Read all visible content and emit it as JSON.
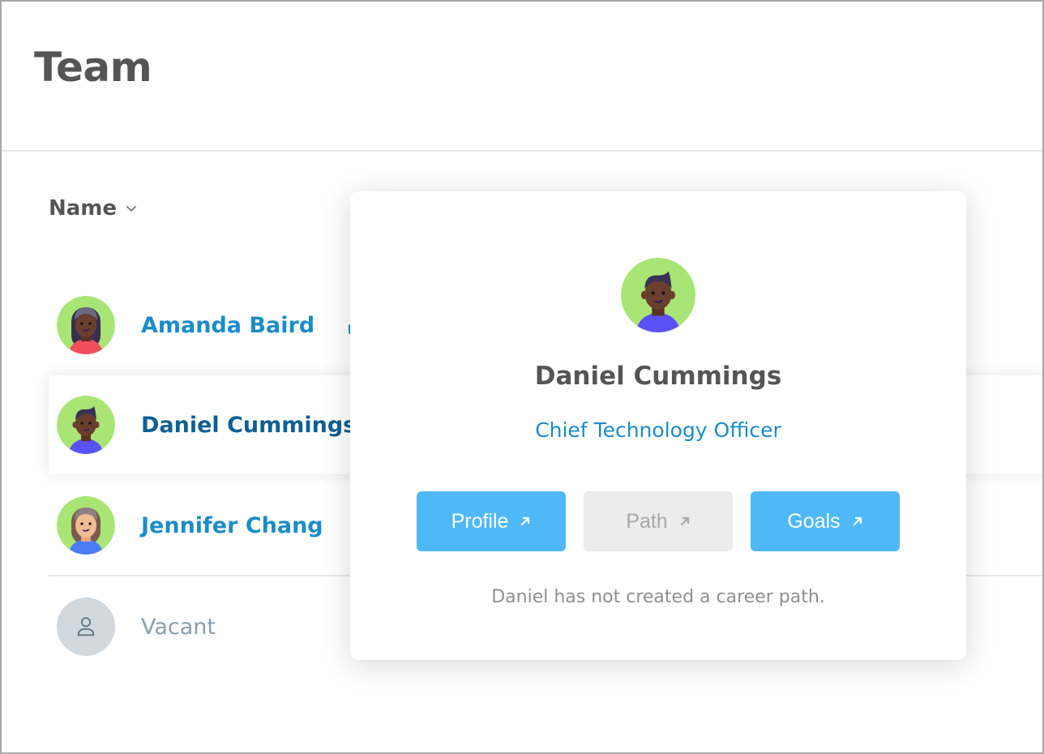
{
  "page": {
    "title": "Team"
  },
  "list": {
    "sort_label": "Name",
    "sort_icon": "chevron-down-icon",
    "members": [
      {
        "name": "Amanda Baird",
        "avatar": "avatar-amanda",
        "state": "normal"
      },
      {
        "name": "Daniel Cummings",
        "avatar": "avatar-daniel",
        "state": "highlighted"
      },
      {
        "name": "Jennifer Chang",
        "avatar": "avatar-jennifer",
        "state": "normal"
      },
      {
        "name": "Vacant",
        "avatar": "person-outline-icon",
        "state": "vacant"
      }
    ]
  },
  "popover": {
    "name": "Daniel Cummings",
    "title": "Chief Technology Officer",
    "buttons": [
      {
        "label": "Profile",
        "icon": "arrow-up-right-icon",
        "enabled": true
      },
      {
        "label": "Path",
        "icon": "arrow-up-right-icon",
        "enabled": false
      },
      {
        "label": "Goals",
        "icon": "arrow-up-right-icon",
        "enabled": true
      }
    ],
    "note": "Daniel has not created a career path."
  },
  "colors": {
    "accent": "#1b8cc8",
    "button_primary": "#4fb9f8",
    "button_disabled": "#ececec",
    "avatar_bg": "#a9e575",
    "vacant_bg": "#d1d9df"
  }
}
